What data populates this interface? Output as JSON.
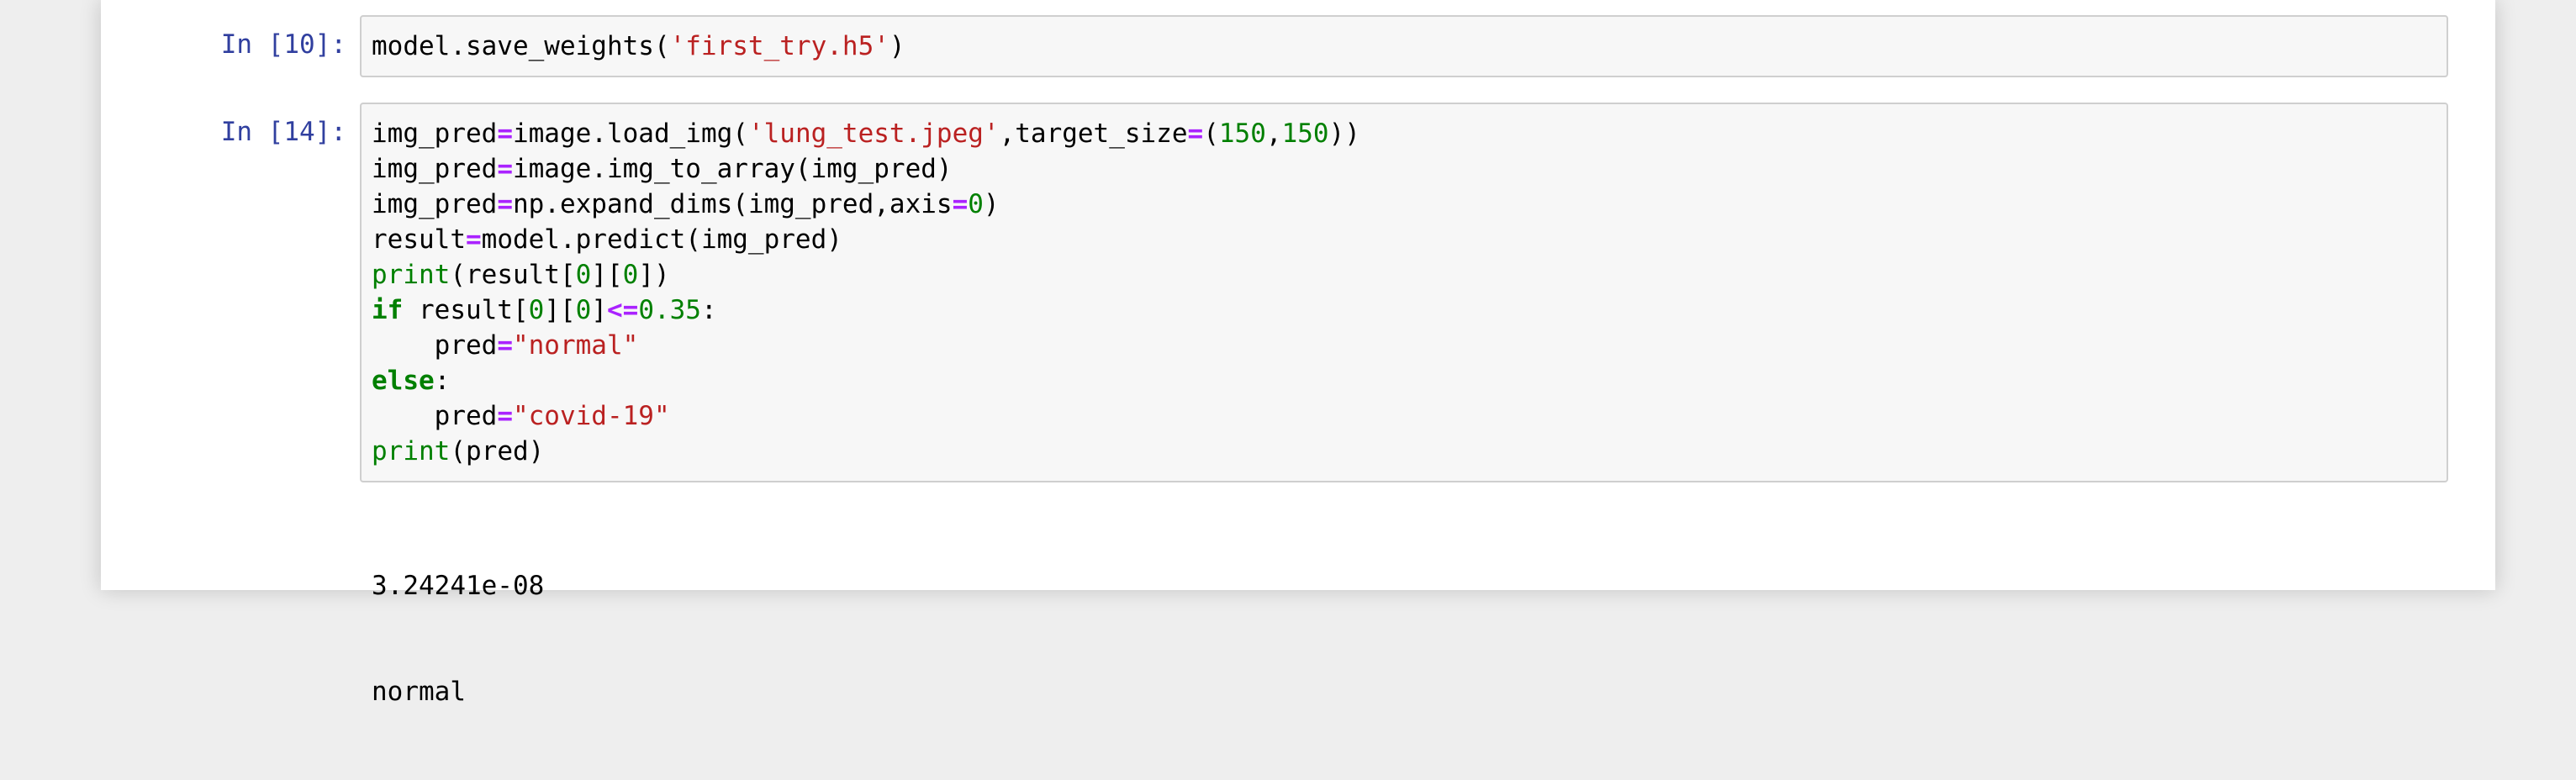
{
  "colors": {
    "prompt": "#303f9f",
    "string": "#ba2121",
    "number": "#008000",
    "operator": "#aa22ff",
    "keyword": "#008000",
    "cell_background": "#f7f7f7",
    "cell_border": "#cfcfcf"
  },
  "cells": [
    {
      "prompt": "In [10]:",
      "code_text": "model.save_weights('first_try.h5')",
      "lines": [
        [
          {
            "t": "plain",
            "v": "model.save_weights("
          },
          {
            "t": "str",
            "v": "'first_try.h5'"
          },
          {
            "t": "plain",
            "v": ")"
          }
        ]
      ]
    },
    {
      "prompt": "In [14]:",
      "code_text": "img_pred=image.load_img('lung_test.jpeg',target_size=(150,150))\nimg_pred=image.img_to_array(img_pred)\nimg_pred=np.expand_dims(img_pred,axis=0)\nresult=model.predict(img_pred)\nprint(result[0][0])\nif result[0][0]<=0.35:\n    pred=\"normal\"\nelse:\n    pred=\"covid-19\"\nprint(pred)",
      "lines": [
        [
          {
            "t": "plain",
            "v": "img_pred"
          },
          {
            "t": "op",
            "v": "="
          },
          {
            "t": "plain",
            "v": "image.load_img("
          },
          {
            "t": "str",
            "v": "'lung_test.jpeg'"
          },
          {
            "t": "plain",
            "v": ",target_size"
          },
          {
            "t": "op",
            "v": "="
          },
          {
            "t": "plain",
            "v": "("
          },
          {
            "t": "num",
            "v": "150"
          },
          {
            "t": "plain",
            "v": ","
          },
          {
            "t": "num",
            "v": "150"
          },
          {
            "t": "plain",
            "v": "))"
          }
        ],
        [
          {
            "t": "plain",
            "v": "img_pred"
          },
          {
            "t": "op",
            "v": "="
          },
          {
            "t": "plain",
            "v": "image.img_to_array(img_pred)"
          }
        ],
        [
          {
            "t": "plain",
            "v": "img_pred"
          },
          {
            "t": "op",
            "v": "="
          },
          {
            "t": "plain",
            "v": "np.expand_dims(img_pred,axis"
          },
          {
            "t": "op",
            "v": "="
          },
          {
            "t": "num",
            "v": "0"
          },
          {
            "t": "plain",
            "v": ")"
          }
        ],
        [
          {
            "t": "plain",
            "v": "result"
          },
          {
            "t": "op",
            "v": "="
          },
          {
            "t": "plain",
            "v": "model.predict(img_pred)"
          }
        ],
        [
          {
            "t": "bi",
            "v": "print"
          },
          {
            "t": "plain",
            "v": "(result["
          },
          {
            "t": "num",
            "v": "0"
          },
          {
            "t": "plain",
            "v": "]["
          },
          {
            "t": "num",
            "v": "0"
          },
          {
            "t": "plain",
            "v": "])"
          }
        ],
        [
          {
            "t": "kw",
            "v": "if"
          },
          {
            "t": "plain",
            "v": " result["
          },
          {
            "t": "num",
            "v": "0"
          },
          {
            "t": "plain",
            "v": "]["
          },
          {
            "t": "num",
            "v": "0"
          },
          {
            "t": "plain",
            "v": "]"
          },
          {
            "t": "op",
            "v": "<="
          },
          {
            "t": "num",
            "v": "0.35"
          },
          {
            "t": "plain",
            "v": ":"
          }
        ],
        [
          {
            "t": "plain",
            "v": "    pred"
          },
          {
            "t": "op",
            "v": "="
          },
          {
            "t": "str",
            "v": "\"normal\""
          }
        ],
        [
          {
            "t": "kw",
            "v": "else"
          },
          {
            "t": "plain",
            "v": ":"
          }
        ],
        [
          {
            "t": "plain",
            "v": "    pred"
          },
          {
            "t": "op",
            "v": "="
          },
          {
            "t": "str",
            "v": "\"covid-19\""
          }
        ],
        [
          {
            "t": "bi",
            "v": "print"
          },
          {
            "t": "plain",
            "v": "(pred)"
          }
        ]
      ],
      "output": [
        "3.24241e-08",
        "normal"
      ]
    }
  ]
}
